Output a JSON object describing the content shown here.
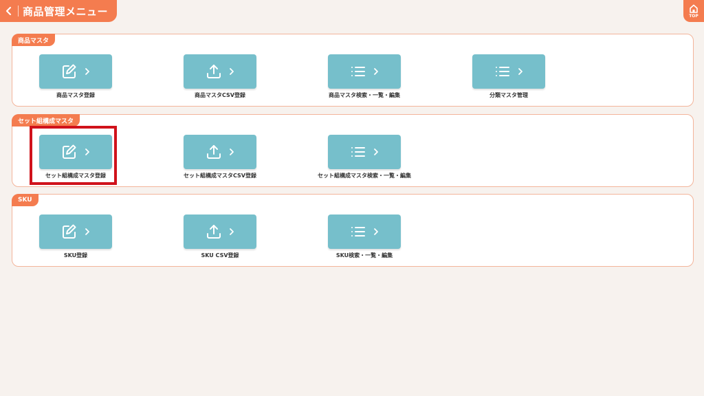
{
  "header": {
    "title": "商品管理メニュー",
    "back_icon": "chevron-left-icon"
  },
  "top_button": {
    "label": "TOP",
    "icon": "home-icon"
  },
  "sections": [
    {
      "title": "商品マスタ",
      "tiles": [
        {
          "label": "商品マスタ登録",
          "icon": "edit-icon"
        },
        {
          "label": "商品マスタCSV登録",
          "icon": "upload-icon"
        },
        {
          "label": "商品マスタ検索・一覧・編集",
          "icon": "list-icon"
        },
        {
          "label": "分類マスタ管理",
          "icon": "list-icon"
        }
      ]
    },
    {
      "title": "セット組構成マスタ",
      "tiles": [
        {
          "label": "セット組構成マスタ登録",
          "icon": "edit-icon",
          "highlighted": true
        },
        {
          "label": "セット組構成マスタCSV登録",
          "icon": "upload-icon"
        },
        {
          "label": "セット組構成マスタ検索・一覧・編集",
          "icon": "list-icon"
        }
      ]
    },
    {
      "title": "SKU",
      "tiles": [
        {
          "label": "SKU登録",
          "icon": "edit-icon"
        },
        {
          "label": "SKU CSV登録",
          "icon": "upload-icon"
        },
        {
          "label": "SKU検索・一覧・編集",
          "icon": "list-icon"
        }
      ]
    }
  ],
  "colors": {
    "accent": "#f47c4f",
    "tile": "#76bfcb",
    "highlight": "#d0121b",
    "background": "#f7f2ee"
  }
}
